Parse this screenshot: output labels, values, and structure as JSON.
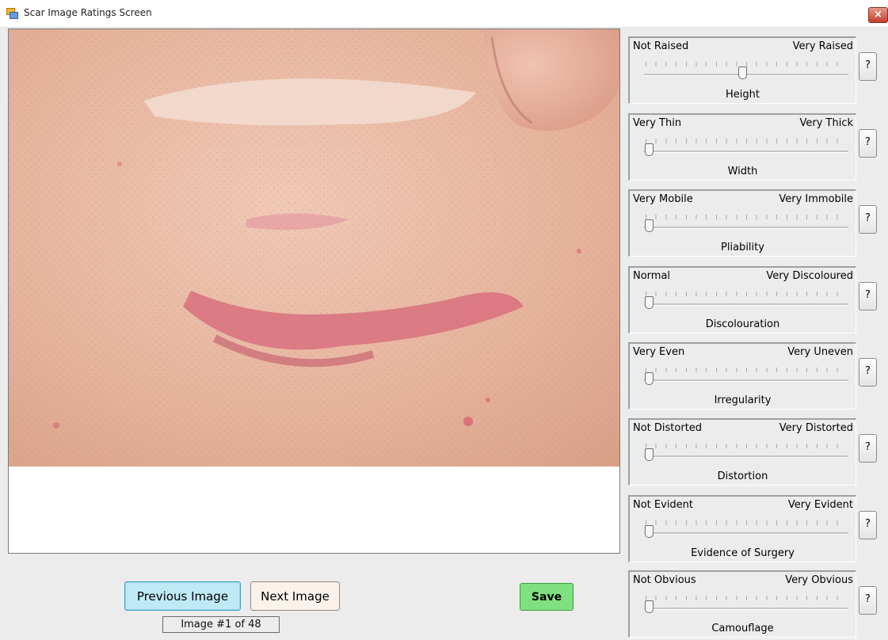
{
  "window": {
    "title": "Scar Image Ratings Screen",
    "close_label": "×"
  },
  "nav": {
    "prev_label": "Previous Image",
    "next_label": "Next Image",
    "save_label": "Save",
    "counter": "Image #1 of 48"
  },
  "ratings": [
    {
      "name": "Height",
      "min_label": "Not Raised",
      "max_label": "Very Raised",
      "value": 0.48
    },
    {
      "name": "Width",
      "min_label": "Very Thin",
      "max_label": "Very Thick",
      "value": 0.0
    },
    {
      "name": "Pliability",
      "min_label": "Very Mobile",
      "max_label": "Very Immobile",
      "value": 0.0
    },
    {
      "name": "Discolouration",
      "min_label": "Normal",
      "max_label": "Very Discoloured",
      "value": 0.0
    },
    {
      "name": "Irregularity",
      "min_label": "Very Even",
      "max_label": "Very Uneven",
      "value": 0.0
    },
    {
      "name": "Distortion",
      "min_label": "Not Distorted",
      "max_label": "Very Distorted",
      "value": 0.0
    },
    {
      "name": "Evidence of Surgery",
      "min_label": "Not Evident",
      "max_label": "Very Evident",
      "value": 0.0
    },
    {
      "name": "Camouflage",
      "min_label": "Not Obvious",
      "max_label": "Very Obvious",
      "value": 0.0
    }
  ],
  "help_label": "?",
  "icons": {
    "app": "app-window-icon",
    "close": "close-icon",
    "help": "help-icon"
  },
  "colors": {
    "prev_button": "#bfe9f5",
    "next_button": "#fbf2ec",
    "save_button": "#7fe07f",
    "close_button": "#c4402b"
  }
}
